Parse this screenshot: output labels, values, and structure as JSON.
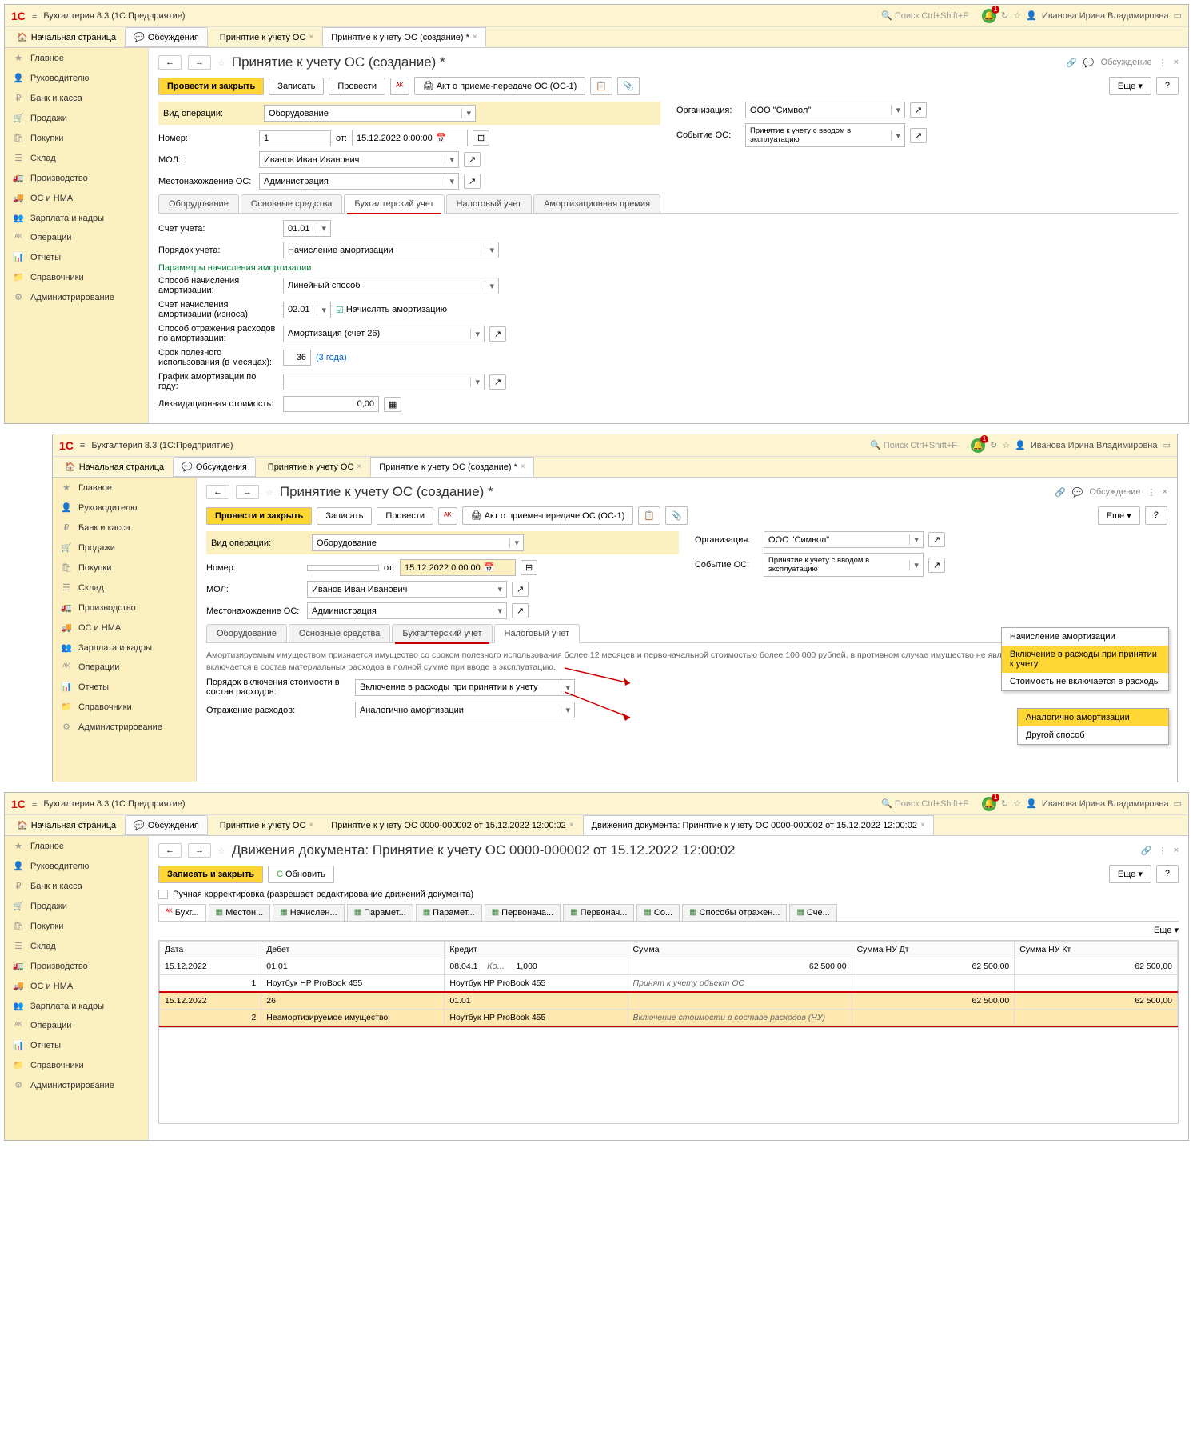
{
  "app": {
    "title": "Бухгалтерия 8.3  (1С:Предприятие)",
    "search_ph": "Поиск Ctrl+Shift+F",
    "user": "Иванова Ирина Владимировна",
    "bell_badge": "1"
  },
  "sidebar": [
    "Главное",
    "Руководителю",
    "Банк и касса",
    "Продажи",
    "Покупки",
    "Склад",
    "Производство",
    "ОС и НМА",
    "Зарплата и кадры",
    "Операции",
    "Отчеты",
    "Справочники",
    "Администрирование"
  ],
  "sidebar_icons": [
    "★",
    "👤",
    "₽",
    "🛒",
    "🛍",
    "☰",
    "🚛",
    "🚚",
    "👥",
    "ᴬᴷ",
    "📊",
    "📁",
    "⚙"
  ],
  "tabs": {
    "home": "Начальная страница",
    "disc": "Обсуждения",
    "t1": "Принятие к учету ОС",
    "t2": "Принятие к учету ОС (создание) *"
  },
  "page": {
    "title": "Принятие к учету ОС (создание) *",
    "btn_post_close": "Провести и закрыть",
    "btn_write": "Записать",
    "btn_post": "Провести",
    "btn_akt": "Акт о приеме-передаче ОС (ОС-1)",
    "btn_more": "Еще",
    "discuss": "Обсуждение"
  },
  "form": {
    "op_lbl": "Вид операции:",
    "op_val": "Оборудование",
    "org_lbl": "Организация:",
    "org_val": "ООО \"Символ\"",
    "num_lbl": "Номер:",
    "num_val": "1",
    "date_lbl": "от:",
    "date_val": "15.12.2022  0:00:00",
    "event_lbl": "Событие ОС:",
    "event_val": "Принятие к учету с вводом в эксплуатацию",
    "mol_lbl": "МОЛ:",
    "mol_val": "Иванов Иван Иванович",
    "loc_lbl": "Местонахождение ОС:",
    "loc_val": "Администрация"
  },
  "doc_tabs": [
    "Оборудование",
    "Основные средства",
    "Бухгалтерский учет",
    "Налоговый учет",
    "Амортизационная премия"
  ],
  "bu": {
    "acct_lbl": "Счет учета:",
    "acct_val": "01.01",
    "order_lbl": "Порядок учета:",
    "order_val": "Начисление амортизации",
    "params": "Параметры начисления амортизации",
    "method_lbl": "Способ начисления амортизации:",
    "method_val": "Линейный способ",
    "amacct_lbl": "Счет начисления амортизации (износа):",
    "amacct_val": "02.01",
    "chk": "Начислять амортизацию",
    "expway_lbl": "Способ отражения расходов по амортизации:",
    "expway_val": "Амортизация (счет 26)",
    "life_lbl": "Срок полезного использования (в месяцах):",
    "life_val": "36",
    "life_hint": "(3 года)",
    "sched_lbl": "График амортизации по году:",
    "liq_lbl": "Ликвидационная стоимость:",
    "liq_val": "0,00"
  },
  "nu": {
    "note": "Амортизируемым имуществом признается имущество со сроком полезного использования более 12 месяцев и первоначальной стоимостью более 100 000 рублей, в противном случае имущество не является амортизируемым, и его стоимость включается в состав материальных расходов в полной сумме при вводе в эксплуатацию.",
    "order_lbl": "Порядок включения стоимости в состав расходов:",
    "order_val": "Включение в расходы при принятии к учету",
    "exp_lbl": "Отражение расходов:",
    "exp_val": "Аналогично амортизации",
    "dd1": [
      "Начисление амортизации",
      "Включение в расходы при принятии к учету",
      "Стоимость не включается в расходы"
    ],
    "dd2": [
      "Аналогично амортизации",
      "Другой способ"
    ]
  },
  "mov": {
    "tabs_extra": [
      "Принятие к учету ОС 0000-000002 от 15.12.2022 12:00:02",
      "Движения документа: Принятие к учету ОС 0000-000002 от 15.12.2022 12:00:02"
    ],
    "title": "Движения документа: Принятие к учету ОС 0000-000002 от 15.12.2022 12:00:02",
    "btn_save": "Записать и закрыть",
    "btn_refresh": "Обновить",
    "btn_more": "Еще",
    "chk": "Ручная корректировка (разрешает редактирование движений документа)",
    "subtabs": [
      "Бухг...",
      "Местон...",
      "Начислен...",
      "Парамет...",
      "Парамет...",
      "Первонача...",
      "Первонач...",
      "Со...",
      "Способы отражен...",
      "Сче..."
    ],
    "cols": [
      "Дата",
      "Дебет",
      "Кредит",
      "Сумма",
      "Сумма НУ Дт",
      "Сумма НУ Кт"
    ],
    "rows": [
      {
        "n": "1",
        "date": "15.12.2022",
        "dr": "01.01",
        "cr": "08.04.1",
        "cr2": "Ко...",
        "qty": "1,000",
        "sum": "62 500,00",
        "nud": "62 500,00",
        "nuc": "62 500,00",
        "dr2": "Ноутбук HP ProBook 455",
        "cr3": "Ноутбук HP ProBook 455",
        "desc": "Принят к учету объект ОС",
        "hl": false
      },
      {
        "n": "2",
        "date": "15.12.2022",
        "dr": "26",
        "cr": "01.01",
        "cr2": "",
        "qty": "",
        "sum": "",
        "nud": "62 500,00",
        "nuc": "62 500,00",
        "dr2": "Неамортизируемое имущество",
        "cr3": "Ноутбук HP ProBook 455",
        "desc": "Включение стоимости в составе расходов (НУ)",
        "hl": true
      }
    ]
  }
}
